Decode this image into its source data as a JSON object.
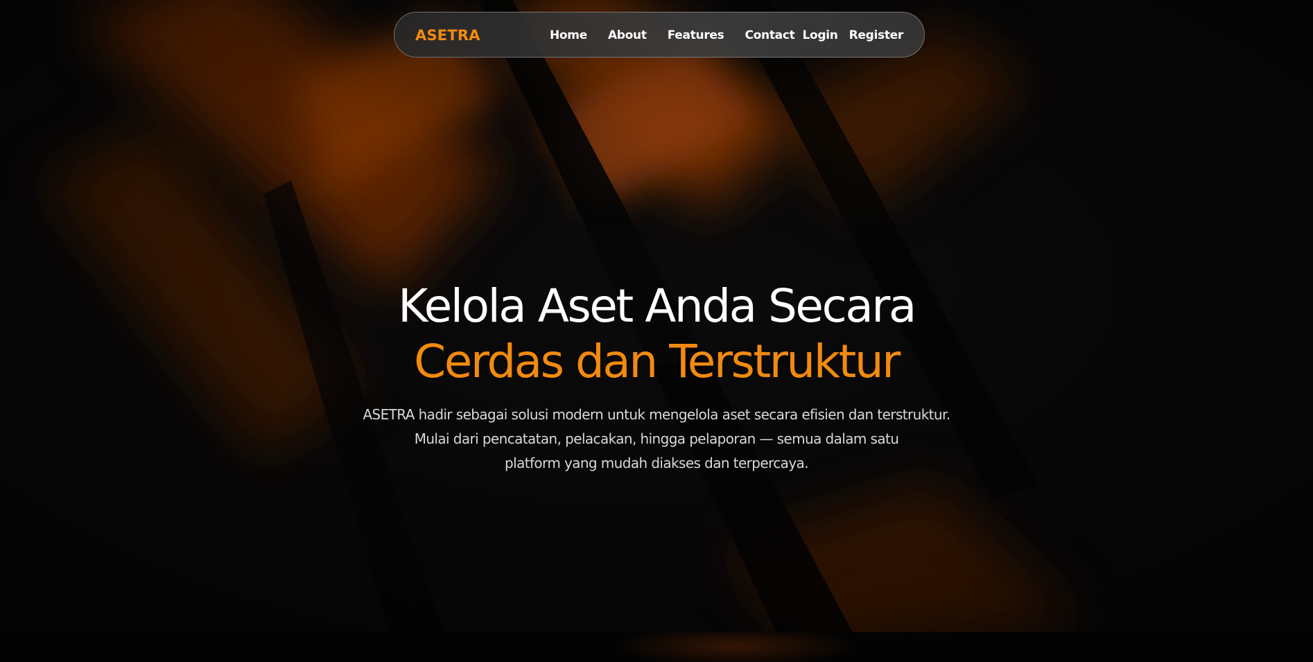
{
  "navbar": {
    "brand": "ASETRA",
    "links": [
      "Home",
      "About",
      "Features",
      "Contact"
    ],
    "login_label": "Login",
    "register_label": "Register"
  },
  "hero": {
    "title_line1": "Kelola Aset Anda Secara",
    "title_line2": "Cerdas dan Terstruktur",
    "description_lines": [
      "ASETRA hadir sebagai solusi modern untuk mengelola aset secara efisien dan terstruktur.",
      "Mulai dari pencatatan, pelacakan, hingga pelaporan — semua dalam satu",
      "platform yang mudah diakses dan terpercaya."
    ]
  },
  "colors": {
    "background": "#0a0a0a",
    "accent": "#f28a10",
    "text": "#ffffff",
    "muted_text": "#d9d9d9"
  }
}
